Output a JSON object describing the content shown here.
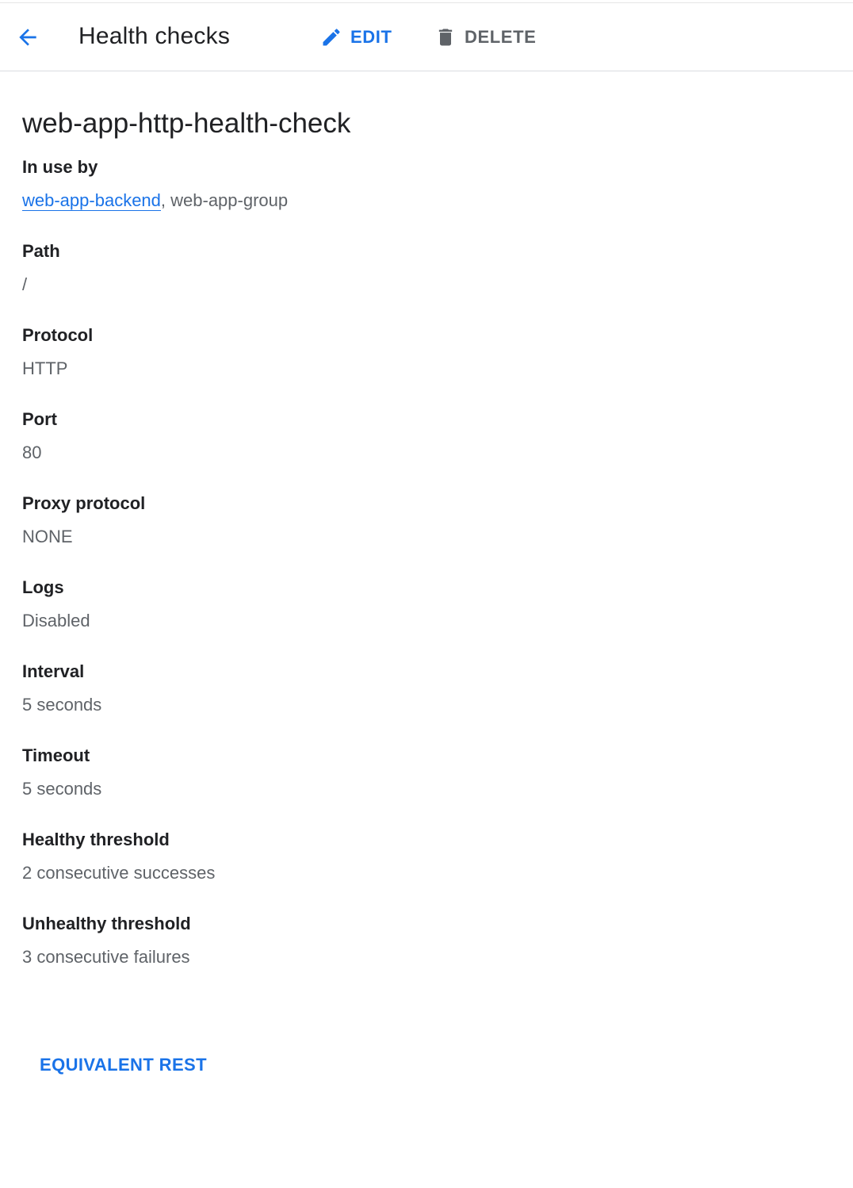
{
  "header": {
    "title": "Health checks",
    "edit_label": "EDIT",
    "delete_label": "DELETE",
    "icons": {
      "back": "arrow-back-icon",
      "edit": "pencil-icon",
      "delete": "trash-icon"
    }
  },
  "details": {
    "name": "web-app-http-health-check",
    "in_use_by": {
      "label": "In use by",
      "link_text": "web-app-backend",
      "separator": ", ",
      "rest_text": "web-app-group"
    },
    "fields": [
      {
        "label": "Path",
        "value": "/"
      },
      {
        "label": "Protocol",
        "value": "HTTP"
      },
      {
        "label": "Port",
        "value": "80"
      },
      {
        "label": "Proxy protocol",
        "value": "NONE"
      },
      {
        "label": "Logs",
        "value": "Disabled"
      },
      {
        "label": "Interval",
        "value": "5 seconds"
      },
      {
        "label": "Timeout",
        "value": "5 seconds"
      },
      {
        "label": "Healthy threshold",
        "value": "2 consecutive successes"
      },
      {
        "label": "Unhealthy threshold",
        "value": "3 consecutive failures"
      }
    ]
  },
  "footer": {
    "equivalent_rest_label": "EQUIVALENT REST"
  },
  "colors": {
    "accent": "#1a73e8",
    "text_primary": "#202124",
    "text_secondary": "#5f6368",
    "divider": "#dadce0"
  }
}
